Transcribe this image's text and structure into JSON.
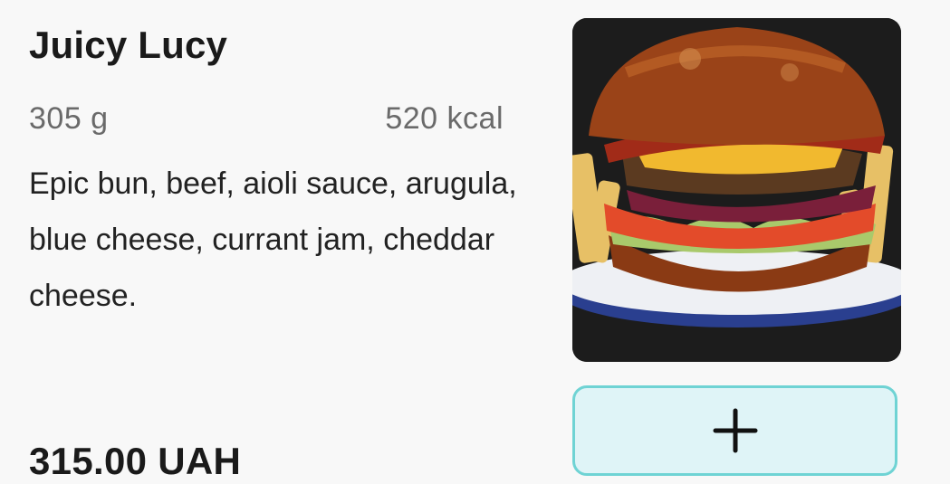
{
  "item": {
    "name": "Juicy Lucy",
    "weight": "305 g",
    "calories": "520 kcal",
    "description": "Epic bun, beef, aioli sauce, arugula, blue cheese, currant jam, cheddar cheese.",
    "price": "315.00 UAH",
    "image_icon": "burger-photo"
  },
  "actions": {
    "add_icon": "plus-icon"
  },
  "colors": {
    "button_bg": "#dff4f7",
    "button_border": "#6fd3d4",
    "text": "#1a1a1a",
    "muted": "#6a6a6a"
  }
}
